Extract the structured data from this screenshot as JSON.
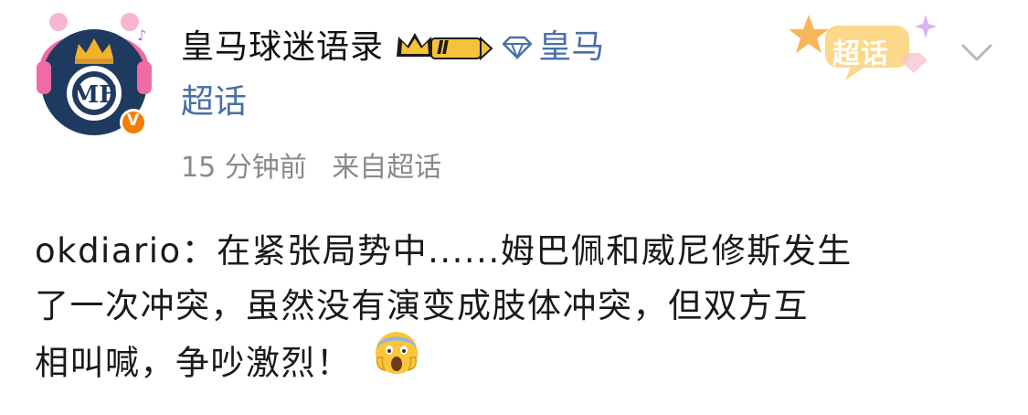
{
  "post": {
    "author": {
      "name": "皇马球迷语录",
      "vip_level": "Ⅱ",
      "topic_tag": "皇马",
      "second_line": "超话",
      "verified_mark": "V"
    },
    "meta": {
      "time": "15 分钟前",
      "source": "来自超话"
    },
    "supertopic_badge": "超话",
    "content_lines": [
      "okdiario：在紧张局势中......姆巴佩和威尼修斯发生",
      "了一次冲突，虽然没有演变成肢体冲突，但双方互",
      "相叫喊，争吵激烈！"
    ],
    "emoji": "screaming-face"
  },
  "colors": {
    "link_blue": "#4a6fa8",
    "meta_gray": "#8a8a8a",
    "verified_orange": "#f57c00",
    "headphone_pink": "#f06aa6",
    "avatar_navy": "#1f3a5f",
    "crown_gold": "#f2b230"
  }
}
